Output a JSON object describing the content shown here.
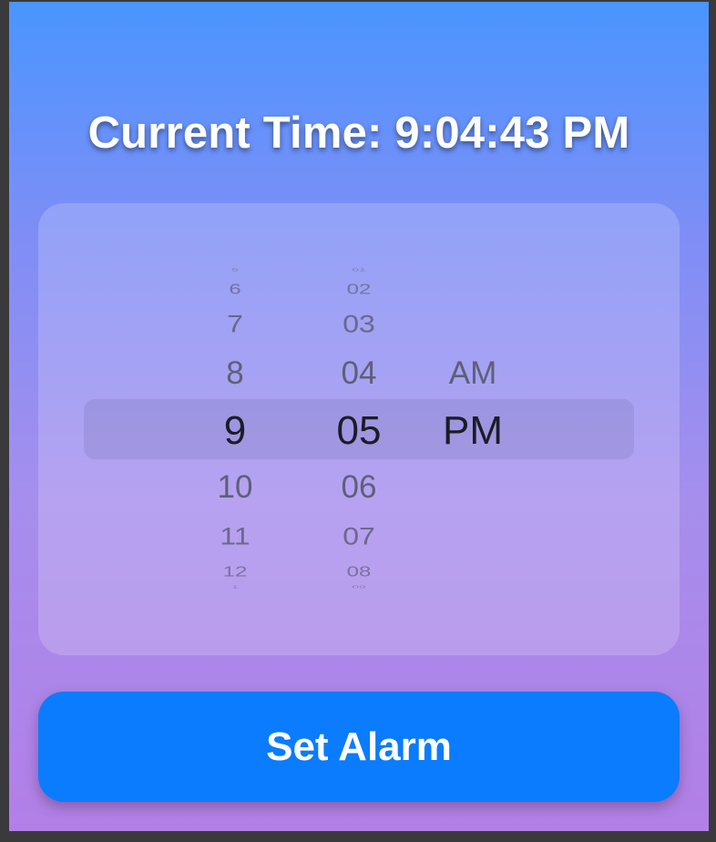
{
  "header": {
    "current_time": "Current Time: 9:04:43 PM"
  },
  "picker": {
    "hours": [
      "5",
      "6",
      "7",
      "8",
      "9",
      "10",
      "11",
      "12",
      "1"
    ],
    "minutes": [
      "01",
      "02",
      "03",
      "04",
      "05",
      "06",
      "07",
      "08",
      "09"
    ],
    "periods": [
      "AM",
      "PM"
    ],
    "selected": {
      "hour": "9",
      "minute": "05",
      "period": "PM"
    }
  },
  "actions": {
    "set_alarm_label": "Set Alarm"
  },
  "colors": {
    "background_top": "#4a95ff",
    "background_bottom": "#b27fe6",
    "button": "#0a7cfd",
    "button_text": "#ffffff"
  }
}
